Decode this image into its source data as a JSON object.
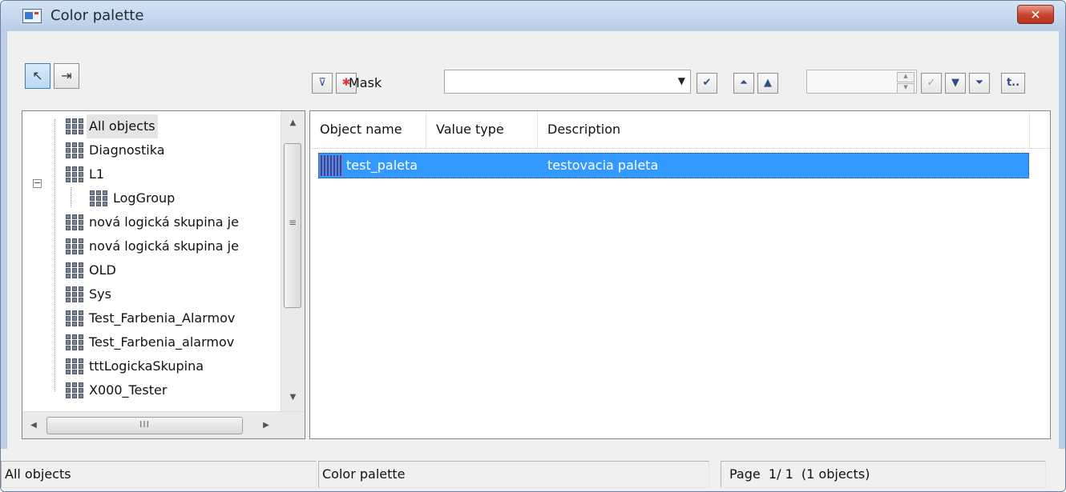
{
  "window": {
    "title": "Color palette",
    "close_glyph": "✕"
  },
  "toolbar": {
    "pointer_glyph": "↖",
    "exit_glyph": "⇥",
    "filter_glyph": "⊽",
    "clear_glyph": "✱",
    "mask_label": "Mask",
    "mask_value": "",
    "dropdown_glyph": "▼",
    "confirm_glyph": "✔",
    "first_glyph": "⏶",
    "prev_glyph": "▲",
    "page_value": "",
    "spin_up": "▲",
    "spin_down": "▼",
    "go_glyph": "✓",
    "next_glyph": "▼",
    "last_glyph": "⏷",
    "up_level_glyph": "t..",
    "icons": [
      "pointer-icon",
      "exit-icon",
      "filter-icon",
      "clear-filter-icon",
      "first-page-icon",
      "previous-page-icon",
      "next-page-icon",
      "last-page-icon",
      "up-level-icon"
    ]
  },
  "tree": {
    "items": [
      {
        "label": "All objects"
      },
      {
        "label": "Diagnostika"
      },
      {
        "label": "L1"
      },
      {
        "label": "LogGroup"
      },
      {
        "label": "nová logická skupina je"
      },
      {
        "label": "nová logická skupina je"
      },
      {
        "label": "OLD"
      },
      {
        "label": "Sys"
      },
      {
        "label": "Test_Farbenia_Alarmov"
      },
      {
        "label": "Test_Farbenia_alarmov"
      },
      {
        "label": "tttLogickaSkupina"
      },
      {
        "label": "X000_Tester"
      }
    ],
    "expander_glyph": "−",
    "grip_glyph": "≡",
    "hthumb_glyph": "III",
    "arrows": {
      "up": "▲",
      "down": "▼",
      "left": "◀",
      "right": "▶"
    }
  },
  "list": {
    "columns": [
      "Object name",
      "Value type",
      "Description"
    ],
    "rows": [
      {
        "name": "test_paleta",
        "value_type": "",
        "description": "testovacia paleta"
      }
    ]
  },
  "status": {
    "left": "All objects",
    "middle": "Color palette",
    "right": "Page  1/ 1  (1 objects)"
  },
  "colors": {
    "selection": "#3399ff",
    "frame": "#b9cfe7",
    "close": "#c8412c"
  }
}
